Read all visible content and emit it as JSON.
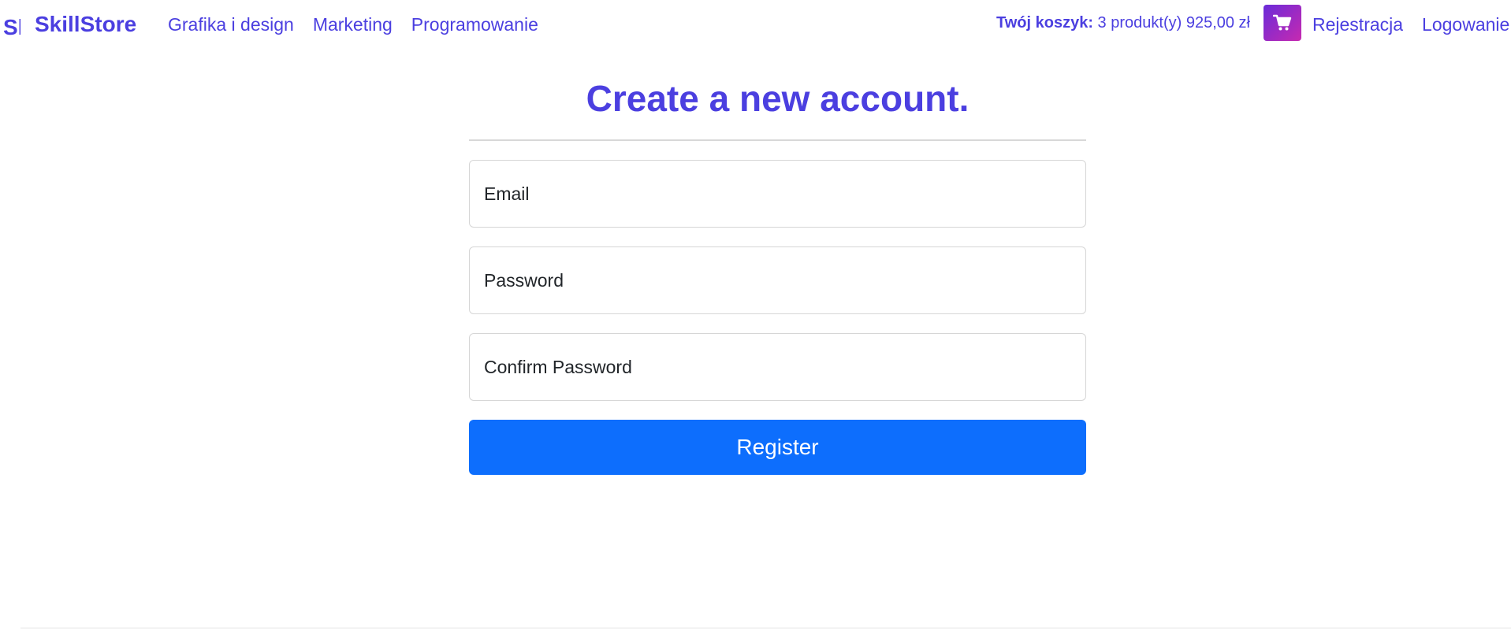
{
  "nav": {
    "logo_text": "SkillStore",
    "brand": "SkillStore",
    "links": [
      "Grafika i design",
      "Marketing",
      "Programowanie"
    ],
    "cart_label": "Twój koszyk:",
    "cart_summary": " 3 produkt(y) 925,00 zł",
    "register_link": "Rejestracja",
    "login_link": "Logowanie"
  },
  "form": {
    "title": "Create a new account.",
    "email_placeholder": "Email",
    "password_placeholder": "Password",
    "confirm_password_placeholder": "Confirm Password",
    "submit_label": "Register"
  },
  "colors": {
    "brand": "#4b3fe0",
    "primary_button": "#0d6efd",
    "cart_gradient_start": "#6a2bd9",
    "cart_gradient_end": "#c72ab0"
  },
  "icons": {
    "cart": "shopping-cart-icon"
  }
}
